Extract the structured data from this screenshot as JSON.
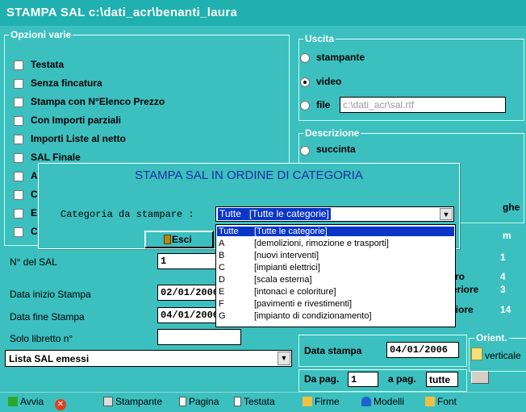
{
  "window": {
    "title": "STAMPA  SAL  c:\\dati_acr\\benanti_laura"
  },
  "opzioni": {
    "title": "Opzioni varie",
    "checkboxes": [
      "Testata",
      "Senza fincatura",
      "Stampa con N°Elenco Prezzo",
      "Con Importi parziali",
      "Importi Liste al netto",
      "SAL Finale",
      "A",
      "C",
      "E",
      "C"
    ]
  },
  "uscita": {
    "title": "Uscita",
    "options": [
      "stampante",
      "video",
      "file"
    ],
    "selected": "video",
    "file_path": "c:\\dati_acr\\sal.rtf"
  },
  "descrizione": {
    "title": "Descrizione",
    "options": [
      "succinta"
    ],
    "partial_label": "ghe"
  },
  "margini": {
    "partial_title": "m",
    "rows": [
      {
        "label": "",
        "value": "1"
      },
      {
        "label": "tro",
        "value": "4"
      },
      {
        "label": "eriore",
        "value": "3"
      },
      {
        "label": "riore",
        "value": "14"
      }
    ]
  },
  "fields": {
    "n_sal_label": "N° del SAL",
    "n_sal_value": "1",
    "data_inizio_label": "Data inizio Stampa",
    "data_inizio_value": "02/01/2006",
    "data_fine_label": "Data fine Stampa",
    "data_fine_value": "04/01/2006",
    "libretto_label": "Solo libretto n°",
    "libretto_value": ""
  },
  "data_stampa": {
    "label": "Data stampa",
    "value": "04/01/2006"
  },
  "pagine": {
    "da_label": "Da pag.",
    "da_value": "1",
    "a_label": "a pag.",
    "a_value": "tutte"
  },
  "orient": {
    "title": "Orient.",
    "options": [
      "verticale",
      ""
    ]
  },
  "lista_sal": {
    "label": "Lista SAL emessi"
  },
  "dialog": {
    "title": "STAMPA SAL IN ORDINE DI CATEGORIA",
    "categoria_label": "Categoria da stampare :",
    "selected_code": "Tutte",
    "selected_desc": "[Tutte le categorie]",
    "exit_button": "Esci",
    "items": [
      {
        "code": "Tutte",
        "desc": "[Tutte le categorie]"
      },
      {
        "code": "A",
        "desc": "[demolizioni, rimozione e trasporti]"
      },
      {
        "code": "B",
        "desc": "[nuovi interventi]"
      },
      {
        "code": "C",
        "desc": "[impianti elettrici]"
      },
      {
        "code": "D",
        "desc": "[scala esterna]"
      },
      {
        "code": "E",
        "desc": "[intonaci e coloriture]"
      },
      {
        "code": "F",
        "desc": "[pavimenti e rivestimenti]"
      },
      {
        "code": "G",
        "desc": "[impianto di condizionamento]"
      }
    ]
  },
  "toolbar": [
    "Avvia",
    "",
    "Stampante",
    "Pagina",
    "Testata",
    "Firme",
    "Modelli",
    "Font"
  ]
}
